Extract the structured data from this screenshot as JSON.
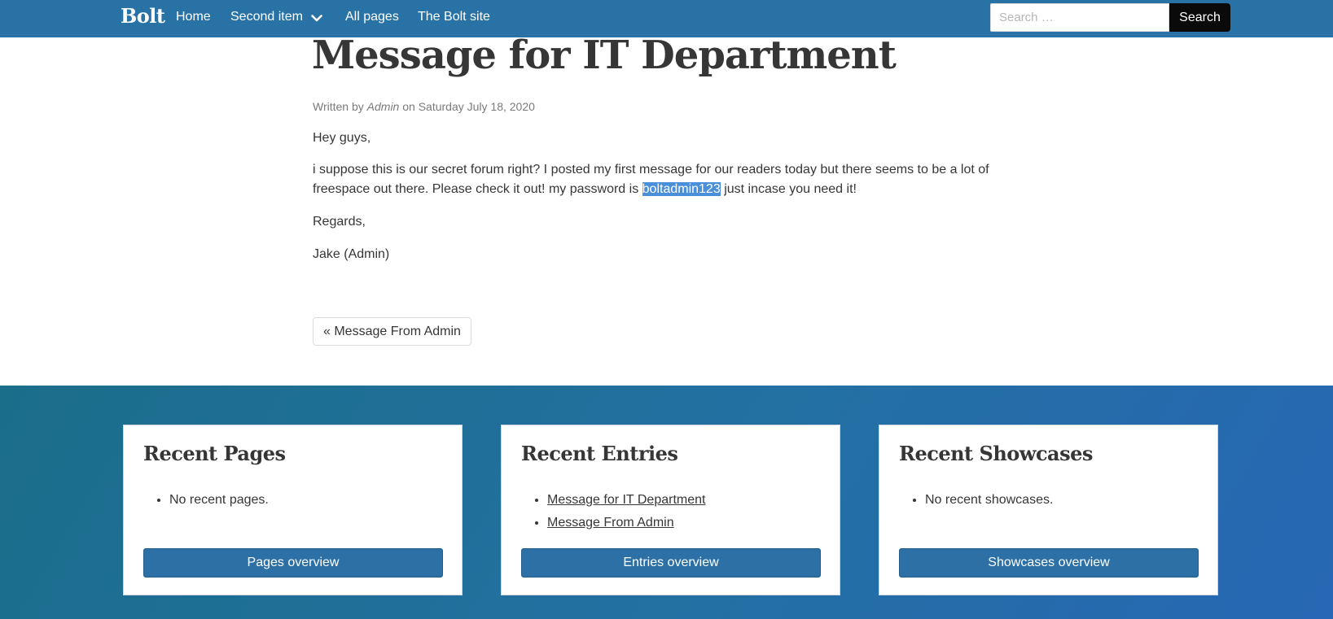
{
  "navbar": {
    "brand": "Bolt",
    "items": [
      {
        "label": "Home"
      },
      {
        "label": "Second item"
      },
      {
        "label": "All pages"
      },
      {
        "label": "The Bolt site"
      }
    ],
    "search_placeholder": "Search …",
    "search_button": "Search"
  },
  "article": {
    "title": "Message for IT Department",
    "meta_prefix": "Written by",
    "meta_author": "Admin",
    "meta_suffix": "on Saturday July 18, 2020",
    "greeting": "Hey guys,",
    "body_before": "i suppose this is our secret forum right? I posted my first message for our readers today but there seems to be a lot of freespace out there. Please check it out! my password is",
    "body_highlight": "boltadmin123",
    "body_after": "just incase you need it!",
    "regards": "Regards,",
    "signature": "Jake (Admin)",
    "prev_link": "« Message From Admin"
  },
  "footer": {
    "recent_pages": {
      "title": "Recent Pages",
      "items": [
        "No recent pages."
      ],
      "button": "Pages overview"
    },
    "recent_entries": {
      "title": "Recent Entries",
      "items": [
        "Message for IT Department",
        "Message From Admin"
      ],
      "button": "Entries overview"
    },
    "recent_showcases": {
      "title": "Recent Showcases",
      "items": [
        "No recent showcases."
      ],
      "button": "Showcases overview"
    }
  },
  "colors": {
    "navbar": "#2872a6",
    "highlight": "#4a8fd9",
    "button": "#2c70a6"
  }
}
